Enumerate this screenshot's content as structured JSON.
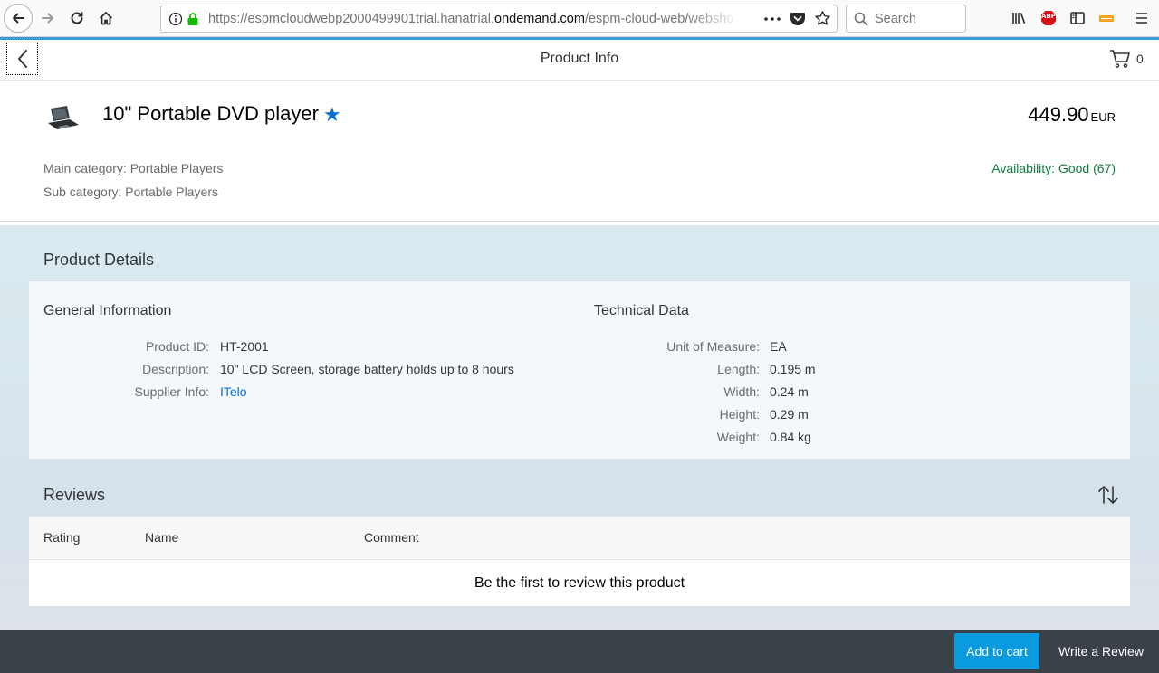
{
  "browser": {
    "url_prefix": "https://espmcloudwebp2000499901trial.hanatrial.",
    "url_host": "ondemand.com",
    "url_suffix": "/espm-cloud-web/webshop/",
    "search_placeholder": "Search",
    "adblock_badge": "ABP"
  },
  "header": {
    "title": "Product Info",
    "cart_count": "0"
  },
  "product": {
    "name": "10\" Portable DVD player",
    "price": "449.90",
    "currency": "EUR",
    "main_category": "Main category: Portable Players",
    "sub_category": "Sub category: Portable Players",
    "availability": "Availability: Good (67)"
  },
  "details": {
    "section_title": "Product Details",
    "general": {
      "title": "General Information",
      "rows": [
        {
          "label": "Product ID:",
          "value": "HT-2001"
        },
        {
          "label": "Description:",
          "value": "10\" LCD Screen, storage battery holds up to 8 hours"
        },
        {
          "label": "Supplier Info:",
          "value": "ITelo"
        }
      ]
    },
    "technical": {
      "title": "Technical Data",
      "rows": [
        {
          "label": "Unit of Measure:",
          "value": "EA"
        },
        {
          "label": "Length:",
          "value": "0.195 m"
        },
        {
          "label": "Width:",
          "value": "0.24 m"
        },
        {
          "label": "Height:",
          "value": "0.29 m"
        },
        {
          "label": "Weight:",
          "value": "0.84 kg"
        }
      ]
    }
  },
  "reviews": {
    "title": "Reviews",
    "columns": [
      "Rating",
      "Name",
      "Comment"
    ],
    "empty_text": "Be the first to review this product"
  },
  "footer": {
    "add_to_cart": "Add to cart",
    "write_review": "Write a Review"
  },
  "colors": {
    "accent": "#0a6ed1",
    "button": "#0a9bde",
    "availability": "#107e3e",
    "footer": "#3b4148"
  }
}
